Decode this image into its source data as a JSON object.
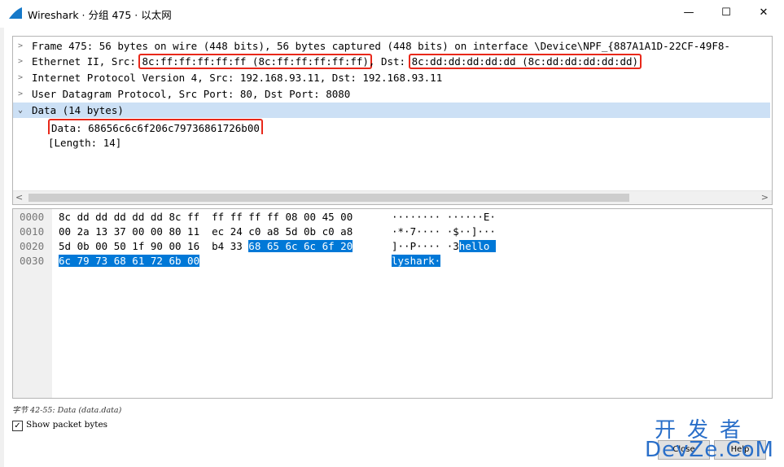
{
  "window": {
    "title": "Wireshark · 分组 475 · 以太网",
    "minimize": "—",
    "maximize": "☐",
    "close": "✕"
  },
  "tree": {
    "frame": "Frame 475: 56 bytes on wire (448 bits), 56 bytes captured (448 bits) on interface \\Device\\NPF_{887A1A1D-22CF-49F8-",
    "ethernet_prefix": "Ethernet II, Src: ",
    "ethernet_src": "8c:ff:ff:ff:ff:ff (8c:ff:ff:ff:ff:ff)",
    "ethernet_dst_label": ", Dst: ",
    "ethernet_dst": "8c:dd:dd:dd:dd:dd (8c:dd:dd:dd:dd:dd)",
    "ip": "Internet Protocol Version 4, Src: 192.168.93.11, Dst: 192.168.93.11",
    "udp": "User Datagram Protocol, Src Port: 80, Dst Port: 8080",
    "data": "Data (14 bytes)",
    "data_value": "Data: 68656c6c6f206c79736861726b00",
    "data_length": "[Length: 14]"
  },
  "bytes": {
    "rows": [
      {
        "offset": "0000",
        "hex": "8c dd dd dd dd dd 8c ff  ff ff ff ff 08 00 45 00",
        "hex_sel": "",
        "ascii": "········ ······E·",
        "ascii_sel": ""
      },
      {
        "offset": "0010",
        "hex": "00 2a 13 37 00 00 80 11  ec 24 c0 a8 5d 0b c0 a8",
        "hex_sel": "",
        "ascii": "·*·7···· ·$··]···",
        "ascii_sel": ""
      },
      {
        "offset": "0020",
        "hex": "5d 0b 00 50 1f 90 00 16  b4 33 ",
        "hex_sel": "68 65 6c 6c 6f 20",
        "ascii": "]··P···· ·3",
        "ascii_sel": "hello "
      },
      {
        "offset": "0030",
        "hex": "",
        "hex_sel": "6c 79 73 68 61 72 6b 00",
        "ascii": "",
        "ascii_sel": "lyshark·"
      }
    ]
  },
  "status": "字节 42-55: Data (data.data)",
  "show_bytes_label": "Show packet bytes",
  "show_bytes_checked": true,
  "buttons": {
    "close": "Close",
    "help": "Help"
  },
  "watermark": {
    "top": "开发者",
    "bottom": "DevZe.CoM"
  }
}
